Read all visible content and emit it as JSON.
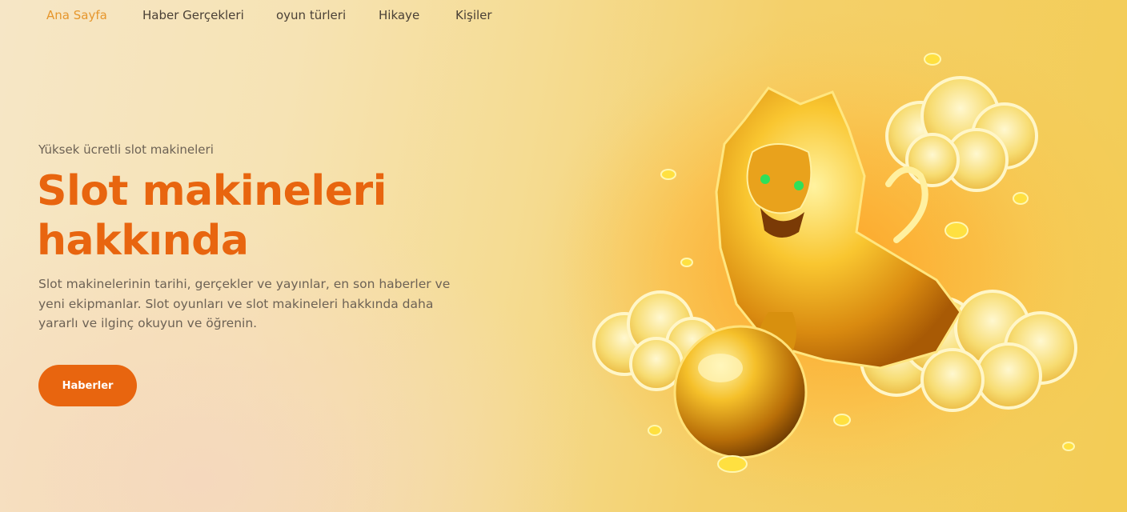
{
  "nav": {
    "items": [
      {
        "label": "Ana Sayfa",
        "active": true
      },
      {
        "label": "Haber Gerçekleri",
        "active": false
      },
      {
        "label": "oyun türleri",
        "active": false
      },
      {
        "label": "Hikaye",
        "active": false
      },
      {
        "label": "Kişiler",
        "active": false
      }
    ]
  },
  "hero": {
    "eyebrow": "Yüksek ücretli slot makineleri",
    "title_line1": "Slot makineleri",
    "title_line2": "hakkında",
    "description": "Slot makinelerinin tarihi, gerçekler ve yayınlar, en son haberler ve yeni ekipmanlar. Slot oyunları ve slot makineleri hakkında daha yararlı ve ilginç okuyun ve öğrenin.",
    "button_label": "Haberler",
    "image_alt": "golden-dragon-on-clouds"
  },
  "colors": {
    "accent": "#e8650f",
    "nav_active": "#e6962c",
    "text_muted": "#6d6255",
    "nav_text": "#4a4036"
  }
}
